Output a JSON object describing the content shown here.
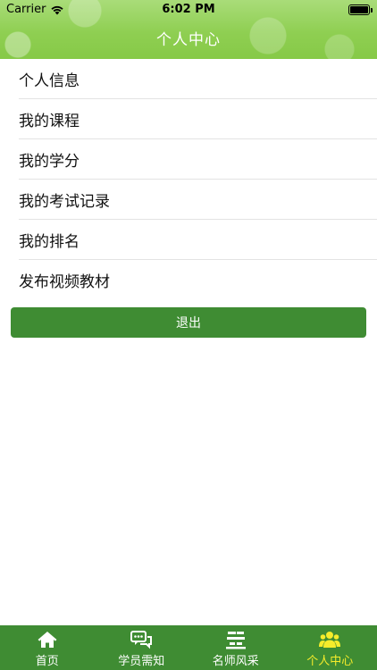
{
  "status_bar": {
    "carrier": "Carrier",
    "time": "6:02 PM"
  },
  "nav": {
    "title": "个人中心"
  },
  "menu": {
    "items": [
      {
        "label": "个人信息"
      },
      {
        "label": "我的课程"
      },
      {
        "label": "我的学分"
      },
      {
        "label": "我的考试记录"
      },
      {
        "label": "我的排名"
      },
      {
        "label": "发布视频教材"
      }
    ]
  },
  "logout_label": "退出",
  "tabbar": {
    "tabs": [
      {
        "label": "首页",
        "icon": "home-icon",
        "active": false
      },
      {
        "label": "学员需知",
        "icon": "chat-bubbles-icon",
        "active": false
      },
      {
        "label": "名师风采",
        "icon": "podium-icon",
        "active": false
      },
      {
        "label": "个人中心",
        "icon": "people-icon",
        "active": true
      }
    ],
    "active_color": "#f5ec2b",
    "bar_color": "#3f8c33"
  },
  "colors": {
    "header_green": "#8fcf52",
    "button_green": "#3f8c33"
  }
}
